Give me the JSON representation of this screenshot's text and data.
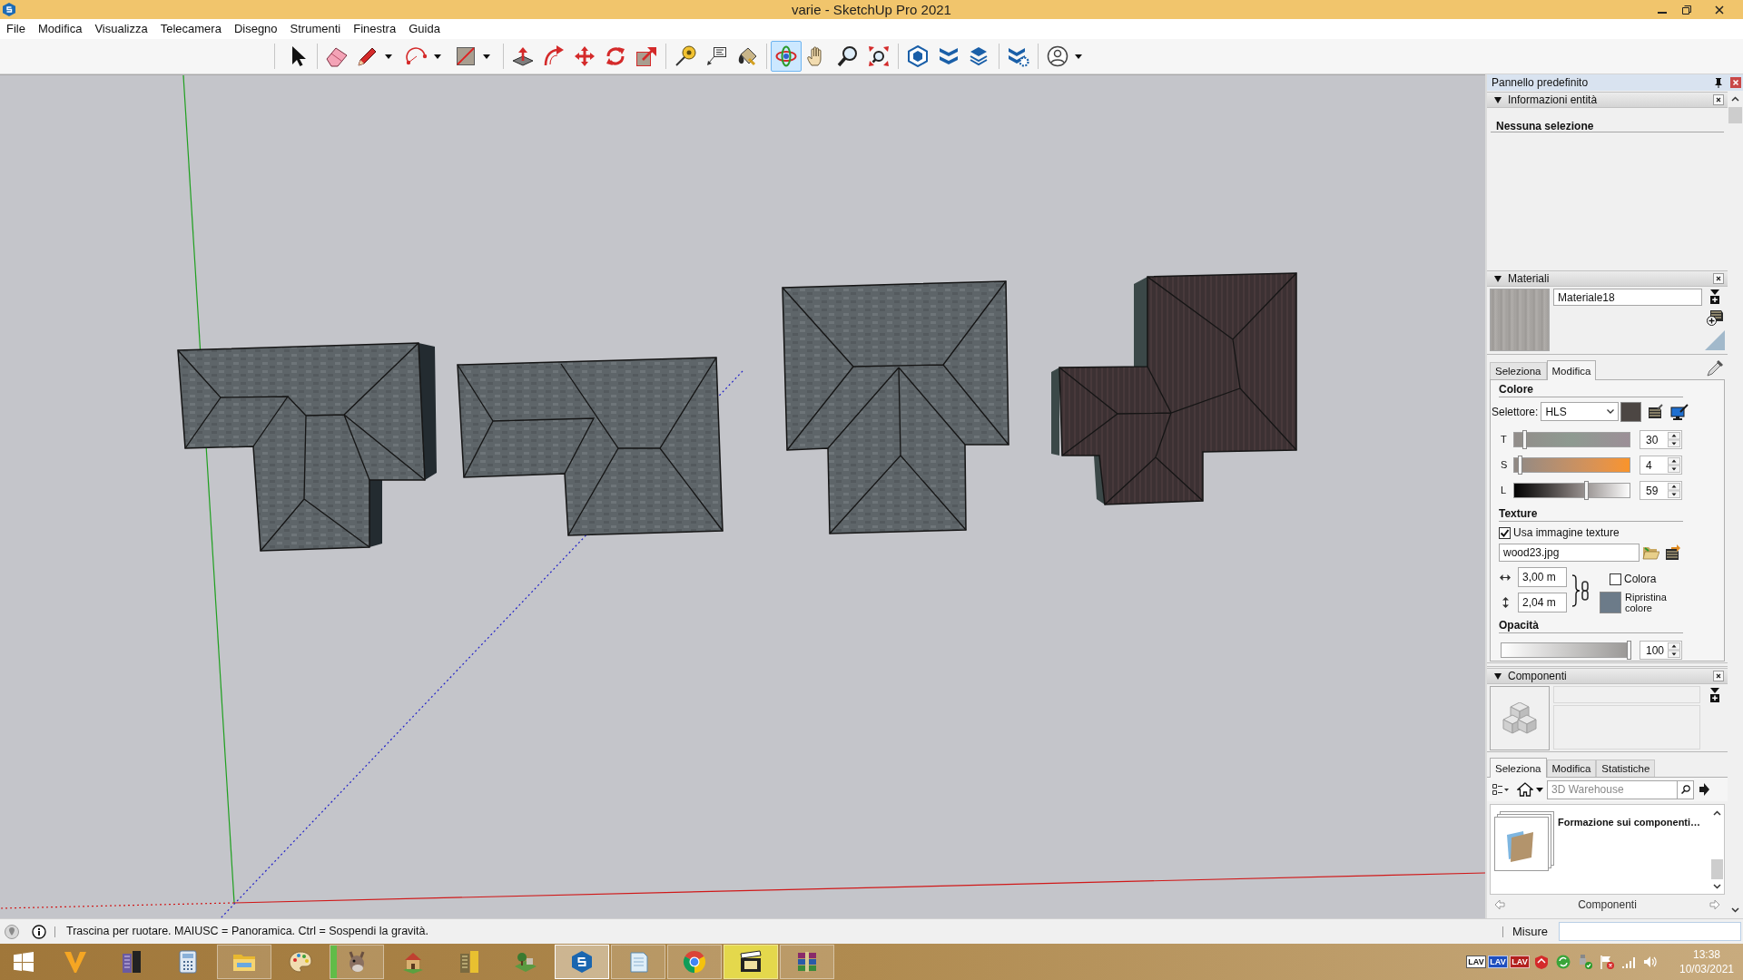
{
  "window": {
    "title": "varie - SketchUp Pro 2021"
  },
  "menu": [
    "File",
    "Modifica",
    "Visualizza",
    "Telecamera",
    "Disegno",
    "Strumenti",
    "Finestra",
    "Guida"
  ],
  "toolbar": [
    {
      "kind": "tool",
      "selected": false,
      "dropdown": false
    },
    {
      "kind": "separator"
    },
    {
      "kind": "tool",
      "selected": false,
      "dropdown": false
    },
    {
      "kind": "tool",
      "selected": false,
      "dropdown": true
    },
    {
      "kind": "tool",
      "selected": false,
      "dropdown": true
    },
    {
      "kind": "tool",
      "selected": false,
      "dropdown": true
    },
    {
      "kind": "separator"
    },
    {
      "kind": "tool",
      "selected": false,
      "dropdown": false
    },
    {
      "kind": "tool",
      "selected": false,
      "dropdown": false
    },
    {
      "kind": "tool",
      "selected": false,
      "dropdown": false
    },
    {
      "kind": "tool",
      "selected": false,
      "dropdown": false
    },
    {
      "kind": "tool",
      "selected": false,
      "dropdown": false
    },
    {
      "kind": "separator"
    },
    {
      "kind": "tool",
      "selected": false,
      "dropdown": false
    },
    {
      "kind": "tool",
      "selected": false,
      "dropdown": false
    },
    {
      "kind": "tool",
      "selected": false,
      "dropdown": false
    },
    {
      "kind": "separator"
    },
    {
      "kind": "tool",
      "selected": true,
      "dropdown": false
    },
    {
      "kind": "tool",
      "selected": false,
      "dropdown": false
    },
    {
      "kind": "tool",
      "selected": false,
      "dropdown": false
    },
    {
      "kind": "tool",
      "selected": false,
      "dropdown": false
    },
    {
      "kind": "separator"
    },
    {
      "kind": "tool",
      "selected": false,
      "dropdown": false
    },
    {
      "kind": "tool",
      "selected": false,
      "dropdown": false
    },
    {
      "kind": "tool",
      "selected": false,
      "dropdown": false
    },
    {
      "kind": "separator"
    },
    {
      "kind": "tool",
      "selected": false,
      "dropdown": false
    },
    {
      "kind": "separator"
    },
    {
      "kind": "tool",
      "selected": false,
      "dropdown": true
    }
  ],
  "tray_panel": {
    "title": "Pannello predefinito",
    "entity_info": {
      "title": "Informazioni entità",
      "expanded": true,
      "message": "Nessuna selezione"
    },
    "materials": {
      "title": "Materiali",
      "expanded": true,
      "name": "Materiale18",
      "tabs": [
        {
          "label": "Seleziona",
          "selected": false
        },
        {
          "label": "Modifica",
          "selected": true
        }
      ],
      "color_heading": "Colore",
      "picker_label": "Selettore:",
      "picker_value": "HLS",
      "channels": [
        {
          "label": "T",
          "level": 0.09,
          "value": "30"
        },
        {
          "label": "S",
          "level": 0.05,
          "value": "4"
        },
        {
          "label": "L",
          "level": 0.62,
          "value": "59"
        }
      ],
      "texture_heading": "Texture",
      "use_texture": {
        "label": "Usa immagine texture",
        "checked": true
      },
      "texture_file": "wood23.jpg",
      "texture_width": "3,00 m",
      "texture_height": "2,04 m",
      "colorize": {
        "label": "Colora",
        "checked": false
      },
      "reset_color_label": "Ripristina colore",
      "opacity_heading": "Opacità",
      "opacity": {
        "level": 1,
        "value": "100"
      }
    },
    "components": {
      "title": "Componenti",
      "expanded": true,
      "tabs": [
        {
          "label": "Seleziona",
          "selected": true
        },
        {
          "label": "Modifica",
          "selected": false
        },
        {
          "label": "Statistiche",
          "selected": false
        }
      ],
      "search": {
        "placeholder": "3D Warehouse"
      },
      "items": [
        {
          "label": "Formazione sui componenti…"
        }
      ],
      "footer": "Componenti"
    }
  },
  "status_bar": {
    "message": "Trascina per ruotare. MAIUSC = Panoramica. Ctrl = Sospendi la gravità.",
    "measurements_label": "Misure"
  },
  "taskbar": {
    "apps": [
      {
        "running": false,
        "selected": false,
        "attention": false
      },
      {
        "running": false,
        "selected": false,
        "attention": false
      },
      {
        "running": false,
        "selected": false,
        "attention": false
      },
      {
        "running": true,
        "selected": false,
        "attention": false
      },
      {
        "running": false,
        "selected": false,
        "attention": false
      },
      {
        "running": true,
        "selected": false,
        "attention": false,
        "level": 0.12
      },
      {
        "running": false,
        "selected": false,
        "attention": false
      },
      {
        "running": false,
        "selected": false,
        "attention": false
      },
      {
        "running": false,
        "selected": false,
        "attention": false
      },
      {
        "running": true,
        "selected": true,
        "attention": false
      },
      {
        "running": true,
        "selected": false,
        "attention": false
      },
      {
        "running": true,
        "selected": false,
        "attention": false
      },
      {
        "running": true,
        "selected": false,
        "attention": true
      },
      {
        "running": true,
        "selected": false,
        "attention": false
      }
    ],
    "tray": [
      {
        "kind": "badge",
        "label": "LAV",
        "color": "#ffffff"
      },
      {
        "kind": "badge",
        "label": "LAV",
        "color": "#1f4fbf"
      },
      {
        "kind": "badge",
        "label": "LAV",
        "color": "#b3201e"
      },
      {
        "kind": "icon"
      },
      {
        "kind": "icon"
      },
      {
        "kind": "icon"
      },
      {
        "kind": "icon"
      },
      {
        "kind": "icon"
      },
      {
        "kind": "icon"
      }
    ],
    "time": "13:38",
    "date": "10/03/2021"
  }
}
